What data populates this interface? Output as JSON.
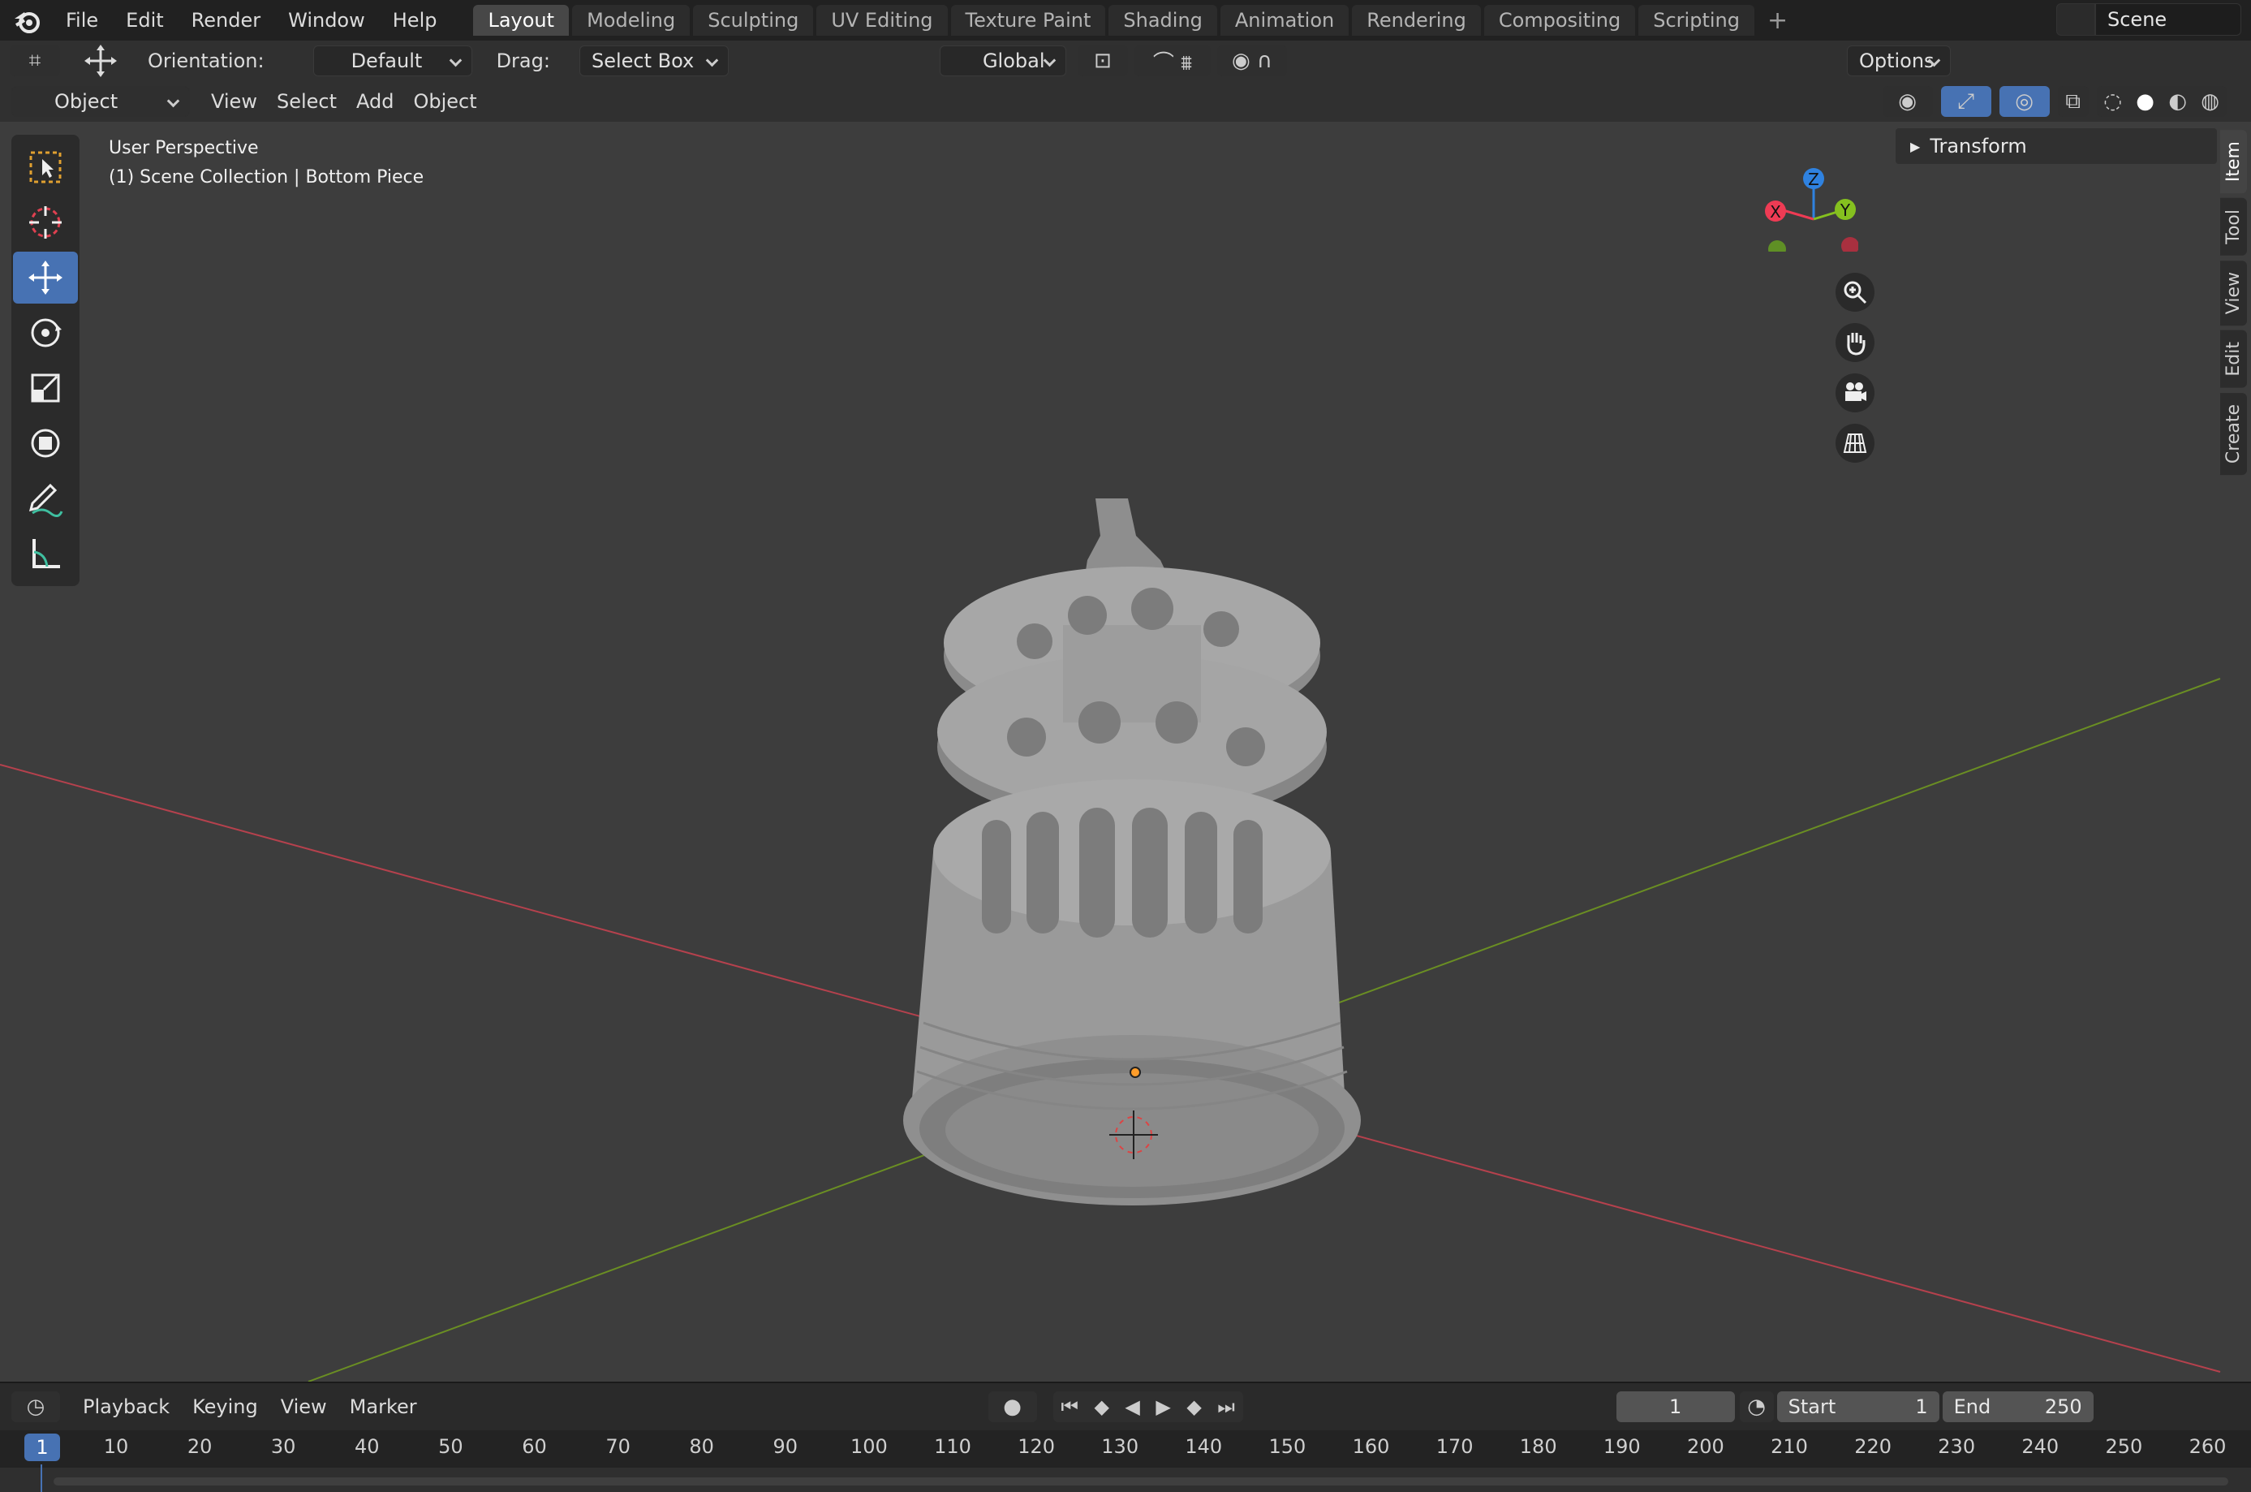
{
  "menu": {
    "file": "File",
    "edit": "Edit",
    "render": "Render",
    "window": "Window",
    "help": "Help"
  },
  "workspaces": [
    "Layout",
    "Modeling",
    "Sculpting",
    "UV Editing",
    "Texture Paint",
    "Shading",
    "Animation",
    "Rendering",
    "Compositing",
    "Scripting"
  ],
  "scene": "Scene",
  "toolbar": {
    "orientation_label": "Orientation:",
    "orientation_value": "Default",
    "drag_label": "Drag:",
    "drag_value": "Select Box",
    "transform_space": "Global",
    "options": "Options"
  },
  "header": {
    "mode": "Object Mode",
    "view": "View",
    "select": "Select",
    "add": "Add",
    "object": "Object"
  },
  "viewport": {
    "perspective": "User Perspective",
    "collection": "(1) Scene Collection | Bottom Piece"
  },
  "gizmo": {
    "x": "X",
    "y": "Y",
    "z": "Z",
    "x_color": "#ee3b54",
    "y_color": "#85c01f",
    "z_color": "#2f82e0"
  },
  "sidebar": {
    "panel": "Transform",
    "tabs": [
      "Item",
      "Tool",
      "View",
      "Edit",
      "Create"
    ]
  },
  "timeline": {
    "playback": "Playback",
    "keying": "Keying",
    "view": "View",
    "marker": "Marker",
    "current_frame": "1",
    "start_label": "Start",
    "start": "1",
    "end_label": "End",
    "end": "250",
    "playhead": "1",
    "ticks": [
      "10",
      "20",
      "30",
      "40",
      "50",
      "60",
      "70",
      "80",
      "90",
      "100",
      "110",
      "120",
      "130",
      "140",
      "150",
      "160",
      "170",
      "180",
      "190",
      "200",
      "210",
      "220",
      "230",
      "240",
      "250",
      "260"
    ]
  },
  "colors": {
    "accent": "#4772b3",
    "axis_x": "#b5414d",
    "axis_y": "#6a8e23",
    "object": "#9a9a9a"
  }
}
